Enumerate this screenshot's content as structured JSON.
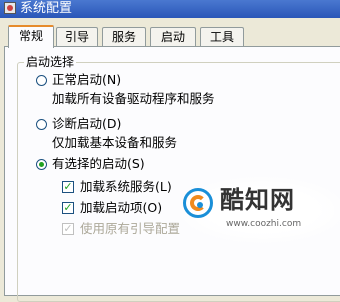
{
  "window": {
    "title": "系统配置"
  },
  "tabs": [
    {
      "label": "常规",
      "active": true
    },
    {
      "label": "引导",
      "active": false
    },
    {
      "label": "服务",
      "active": false
    },
    {
      "label": "启动",
      "active": false
    },
    {
      "label": "工具",
      "active": false
    }
  ],
  "startup_selection": {
    "legend": "启动选择",
    "options": [
      {
        "label": "正常启动(N)",
        "description": "加载所有设备驱动程序和服务",
        "selected": false
      },
      {
        "label": "诊断启动(D)",
        "description": "仅加载基本设备和服务",
        "selected": false
      },
      {
        "label": "有选择的启动(S)",
        "selected": true
      }
    ],
    "checkboxes": [
      {
        "label": "加载系统服务(L)",
        "checked": true,
        "enabled": true
      },
      {
        "label": "加载启动项(O)",
        "checked": true,
        "enabled": true
      },
      {
        "label": "使用原有引导配置",
        "checked": true,
        "enabled": false
      }
    ]
  },
  "watermark": {
    "brand": "酷知网",
    "url": "www.coozhi.com"
  }
}
